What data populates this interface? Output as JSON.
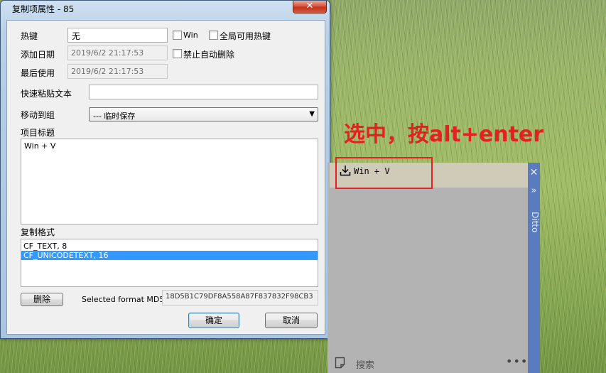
{
  "dialog": {
    "title": "复制项属性 - 85",
    "close_glyph": "✕",
    "hotkey": {
      "label": "热键",
      "value": "无",
      "win_label": "Win",
      "global_label": "全局可用热键"
    },
    "added_date": {
      "label": "添加日期",
      "value": "2019/6/2 21:17:53",
      "no_auto_delete_label": "禁止自动删除"
    },
    "last_used": {
      "label": "最后使用",
      "value": "2019/6/2 21:17:53"
    },
    "quick_paste": {
      "label": "快速粘贴文本",
      "value": ""
    },
    "move_to_group": {
      "label": "移动到组",
      "selected": "--- 临时保存"
    },
    "item_title": {
      "label": "项目标题",
      "value": "Win + V"
    },
    "copy_formats": {
      "label": "复制格式",
      "items": [
        "CF_TEXT, 8",
        "CF_UNICODETEXT, 16"
      ],
      "selected_index": 1
    },
    "delete_button": "删除",
    "md5": {
      "label": "Selected format MD5",
      "value": "18D5B1C79DF8A558A87F837832F98CB3"
    },
    "ok_button": "确定",
    "cancel_button": "取消"
  },
  "annotation": {
    "text": "选中，按alt+enter",
    "color": "#e62020"
  },
  "ditto": {
    "side_title": "Ditto",
    "close_glyph": "✕",
    "chevron_glyph": "»",
    "item_text": "Win + V",
    "item_icon": "download-icon",
    "search_placeholder": "搜索",
    "more_glyph": "•••",
    "accent_color": "#5b7bbf"
  }
}
